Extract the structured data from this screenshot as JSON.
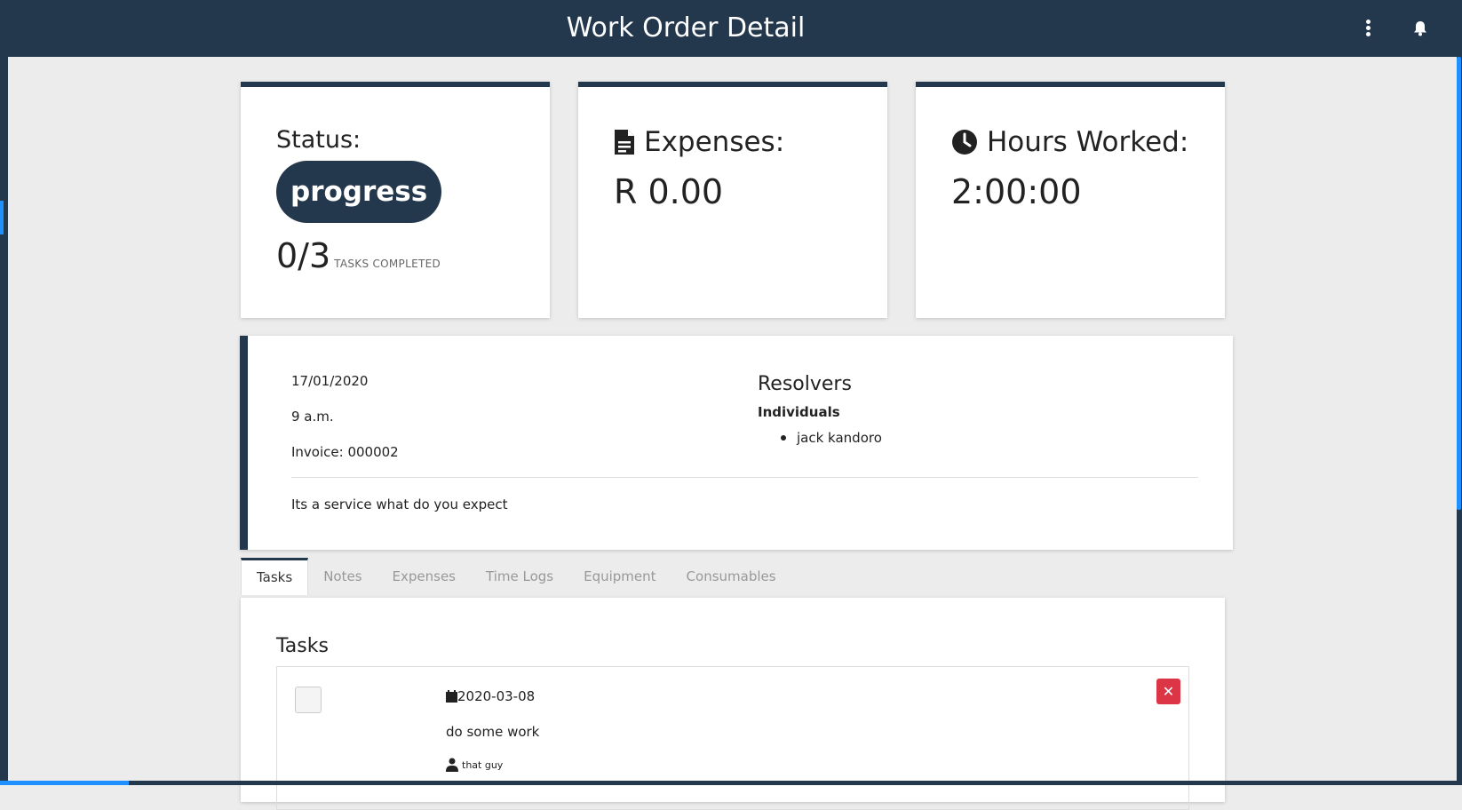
{
  "header": {
    "title": "Work Order Detail",
    "menu_icon": "more-vertical-icon",
    "notify_icon": "bell-icon"
  },
  "status_card": {
    "label": "Status:",
    "status": "progress",
    "count": "0/3",
    "count_label": "TASKS COMPLETED"
  },
  "expenses_card": {
    "label": "Expenses:",
    "value": "R 0.00",
    "icon": "file-icon"
  },
  "hours_card": {
    "label": "Hours Worked:",
    "value": "2:00:00",
    "icon": "clock-icon"
  },
  "info": {
    "date": "17/01/2020",
    "time": "9 a.m.",
    "invoice": "Invoice: 000002",
    "description": "Its a service what do you expect",
    "resolvers_title": "Resolvers",
    "individuals_label": "Individuals",
    "individuals": [
      "jack kandoro"
    ]
  },
  "tabs": [
    "Tasks",
    "Notes",
    "Expenses",
    "Time Logs",
    "Equipment",
    "Consumables"
  ],
  "active_tab": "Tasks",
  "tasks_panel": {
    "title": "Tasks",
    "items": [
      {
        "date": "2020-03-08",
        "description": "do some work",
        "assignee": "that guy",
        "completed": false
      }
    ]
  },
  "colors": {
    "primary": "#23374d",
    "accent": "#1e90ff",
    "danger": "#dc3545"
  }
}
